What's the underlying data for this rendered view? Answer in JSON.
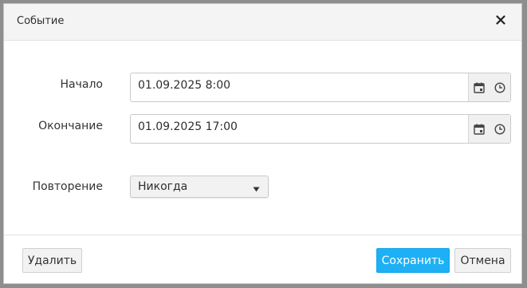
{
  "dialog": {
    "title": "Событие",
    "close_icon": "close-icon"
  },
  "form": {
    "start": {
      "label": "Начало",
      "value": "01.09.2025 8:00"
    },
    "end": {
      "label": "Окончание",
      "value": "01.09.2025 17:00"
    },
    "repeat": {
      "label": "Повторение",
      "value": "Никогда"
    }
  },
  "footer": {
    "delete_label": "Удалить",
    "save_label": "Сохранить",
    "cancel_label": "Отмена"
  },
  "colors": {
    "primary": "#1eb0f5",
    "title_bg": "#f4f4f4"
  }
}
